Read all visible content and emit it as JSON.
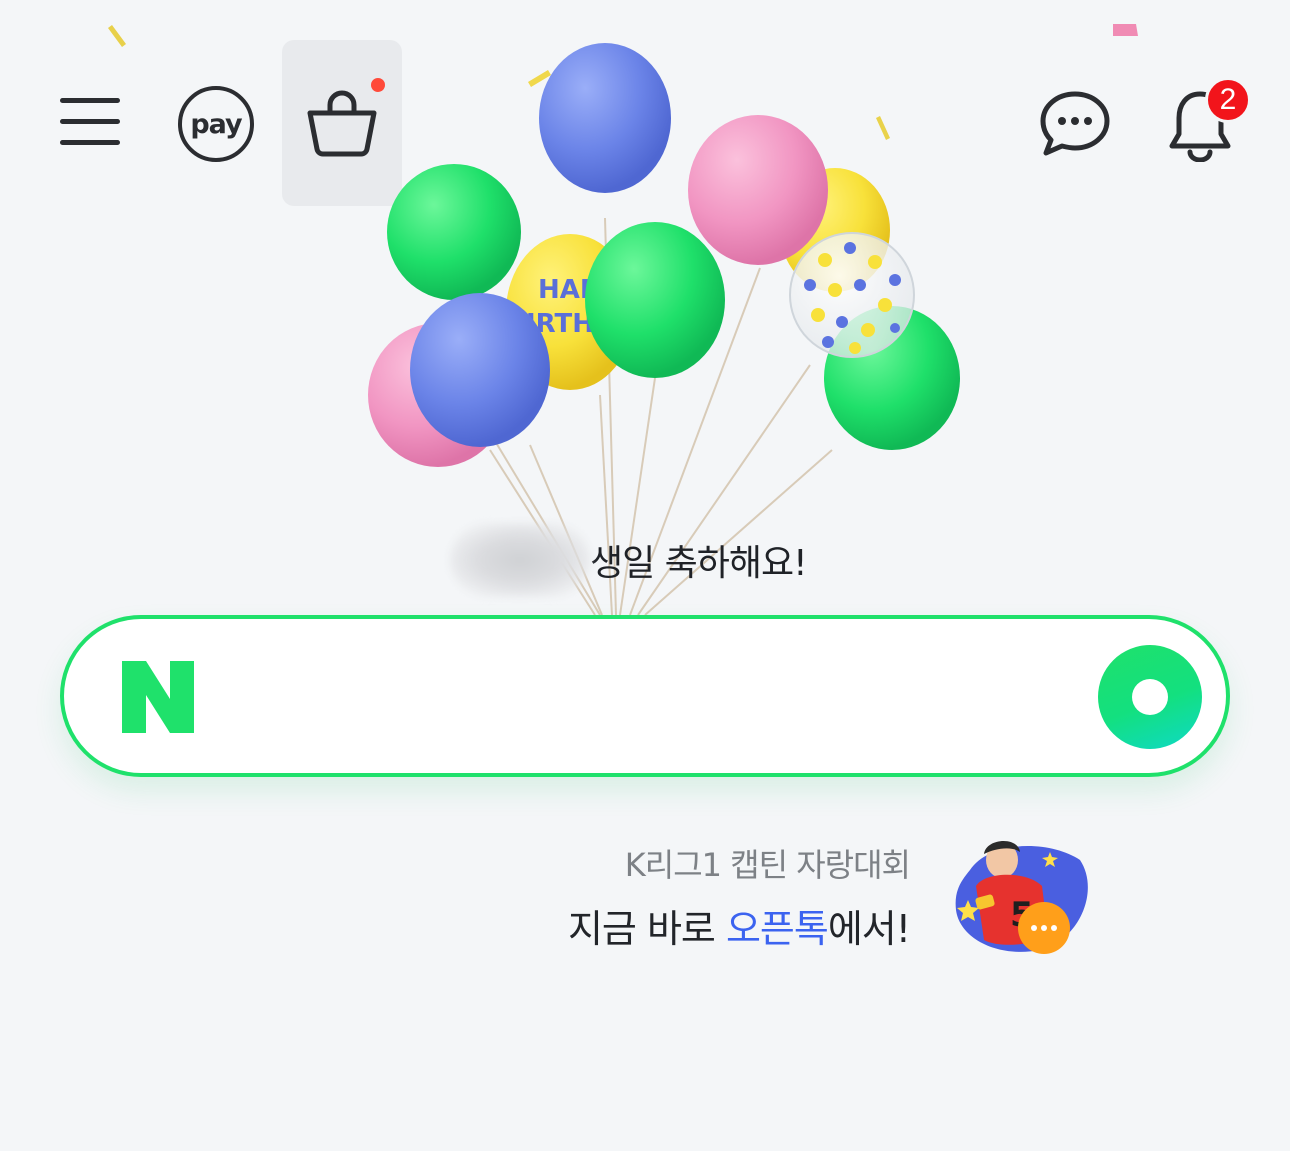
{
  "header": {
    "menu_icon": "hamburger-menu-icon",
    "pay_label": "pay",
    "shopping_icon": "shopping-bag-icon",
    "chat_icon": "speech-bubble-icon",
    "bell_icon": "bell-icon",
    "notification_count": "2"
  },
  "greeting": {
    "text": " 생일 축하해요!"
  },
  "search": {
    "logo_letter": "N",
    "placeholder": "",
    "value": ""
  },
  "promo": {
    "subtitle": "K리그1 캡틴 자랑대회",
    "main_prefix": "지금 바로 ",
    "main_highlight": "오픈톡",
    "main_suffix": "에서!"
  },
  "colors": {
    "brand_green": "#1fe16b",
    "highlight_blue": "#3b63f0",
    "badge_red": "#f2141b"
  }
}
